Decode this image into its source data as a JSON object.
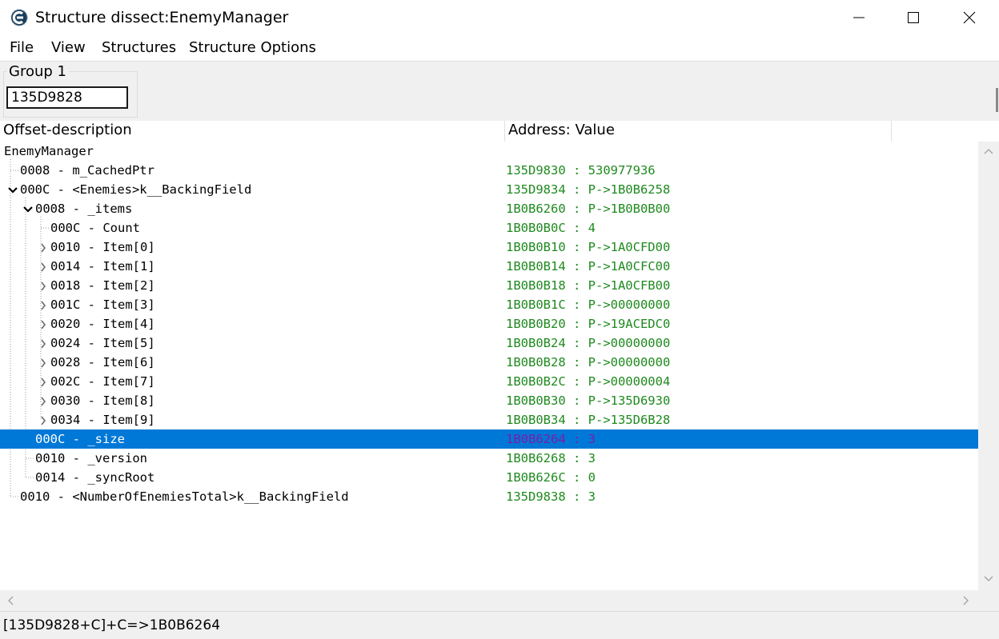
{
  "window": {
    "title": "Structure dissect:EnemyManager",
    "icon": "cheat-engine-icon",
    "controls": [
      "minimize-icon",
      "maximize-icon",
      "close-icon"
    ]
  },
  "menu": [
    "File",
    "View",
    "Structures",
    "Structure Options"
  ],
  "group": {
    "label": "Group 1",
    "address": "135D9828"
  },
  "columns": {
    "description": "Offset-description",
    "value": "Address: Value"
  },
  "tree": [
    {
      "desc": "EnemyManager",
      "value": "",
      "level": 0,
      "expander": "none"
    },
    {
      "desc": "0008 - m_CachedPtr",
      "value": "135D9830 : 530977936",
      "level": 1,
      "expander": "leaf"
    },
    {
      "desc": "000C - <Enemies>k__BackingField",
      "value": "135D9834 : P->1B0B6258",
      "level": 1,
      "expander": "expanded"
    },
    {
      "desc": "0008 - _items",
      "value": "1B0B6260 : P->1B0B0B00",
      "level": 2,
      "expander": "expanded"
    },
    {
      "desc": "000C - Count",
      "value": "1B0B0B0C : 4",
      "level": 3,
      "expander": "leaf"
    },
    {
      "desc": "0010 - Item[0]",
      "value": "1B0B0B10 : P->1A0CFD00",
      "level": 3,
      "expander": "collapsed"
    },
    {
      "desc": "0014 - Item[1]",
      "value": "1B0B0B14 : P->1A0CFC00",
      "level": 3,
      "expander": "collapsed"
    },
    {
      "desc": "0018 - Item[2]",
      "value": "1B0B0B18 : P->1A0CFB00",
      "level": 3,
      "expander": "collapsed"
    },
    {
      "desc": "001C - Item[3]",
      "value": "1B0B0B1C : P->00000000",
      "level": 3,
      "expander": "collapsed"
    },
    {
      "desc": "0020 - Item[4]",
      "value": "1B0B0B20 : P->19ACEDC0",
      "level": 3,
      "expander": "collapsed"
    },
    {
      "desc": "0024 - Item[5]",
      "value": "1B0B0B24 : P->00000000",
      "level": 3,
      "expander": "collapsed"
    },
    {
      "desc": "0028 - Item[6]",
      "value": "1B0B0B28 : P->00000000",
      "level": 3,
      "expander": "collapsed"
    },
    {
      "desc": "002C - Item[7]",
      "value": "1B0B0B2C : P->00000004",
      "level": 3,
      "expander": "collapsed"
    },
    {
      "desc": "0030 - Item[8]",
      "value": "1B0B0B30 : P->135D6930",
      "level": 3,
      "expander": "collapsed"
    },
    {
      "desc": "0034 - Item[9]",
      "value": "1B0B0B34 : P->135D6B28",
      "level": 3,
      "expander": "collapsed"
    },
    {
      "desc": "000C - _size",
      "value": "1B0B6264 : 3",
      "level": 2,
      "expander": "leaf",
      "selected": true
    },
    {
      "desc": "0010 - _version",
      "value": "1B0B6268 : 3",
      "level": 2,
      "expander": "leaf"
    },
    {
      "desc": "0014 - _syncRoot",
      "value": "1B0B626C : 0",
      "level": 2,
      "expander": "leaf"
    },
    {
      "desc": "0010 - <NumberOfEnemiesTotal>k__BackingField",
      "value": "135D9838 : 3",
      "level": 1,
      "expander": "leaf"
    }
  ],
  "status": "[135D9828+C]+C=>1B0B6264",
  "colors": {
    "value_text": "#1f8a1f",
    "selection": "#0078d7",
    "selected_value_text": "#7a1fa8"
  }
}
